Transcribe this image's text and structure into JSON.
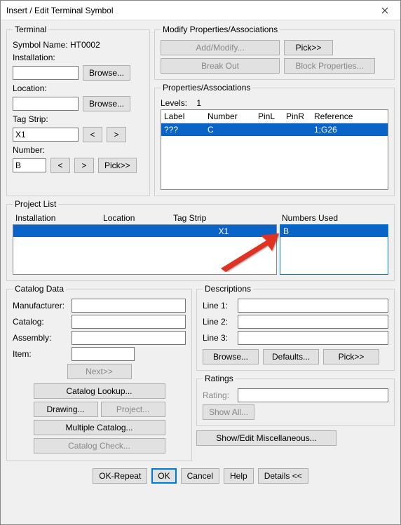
{
  "window": {
    "title": "Insert / Edit Terminal Symbol"
  },
  "terminal": {
    "legend": "Terminal",
    "symbolNameLabel": "Symbol Name:",
    "symbolName": "HT0002",
    "installationLabel": "Installation:",
    "installation": "",
    "browse": "Browse...",
    "locationLabel": "Location:",
    "location": "",
    "tagStripLabel": "Tag Strip:",
    "tagStrip": "X1",
    "prev": "<",
    "next": ">",
    "numberLabel": "Number:",
    "number": "B",
    "pick": "Pick>>"
  },
  "modify": {
    "legend": "Modify Properties/Associations",
    "addModify": "Add/Modify...",
    "pick": "Pick>>",
    "breakOut": "Break Out",
    "blockProps": "Block Properties..."
  },
  "propsAssoc": {
    "legend": "Properties/Associations",
    "levelsLabel": "Levels:",
    "levels": "1",
    "cols": {
      "label": "Label",
      "number": "Number",
      "pinL": "PinL",
      "pinR": "PinR",
      "reference": "Reference"
    },
    "rows": [
      {
        "label": "???",
        "number": "C",
        "pinL": "",
        "pinR": "",
        "reference": "1;G26"
      }
    ]
  },
  "projectList": {
    "legend": "Project List",
    "cols": {
      "installation": "Installation",
      "location": "Location",
      "tagStrip": "Tag Strip",
      "numbersUsed": "Numbers Used"
    },
    "row": {
      "installation": "",
      "location": "",
      "tagStrip": "X1",
      "numbersUsed": "B"
    }
  },
  "catalog": {
    "legend": "Catalog Data",
    "manufacturerLabel": "Manufacturer:",
    "manufacturer": "",
    "catalogLabel": "Catalog:",
    "catalogVal": "",
    "assemblyLabel": "Assembly:",
    "assembly": "",
    "itemLabel": "Item:",
    "item": "",
    "next": "Next>>",
    "lookup": "Catalog Lookup...",
    "drawing": "Drawing...",
    "project": "Project...",
    "multiple": "Multiple Catalog...",
    "check": "Catalog Check..."
  },
  "descriptions": {
    "legend": "Descriptions",
    "line1Label": "Line 1:",
    "line1": "",
    "line2Label": "Line 2:",
    "line2": "",
    "line3Label": "Line 3:",
    "line3": "",
    "browse": "Browse...",
    "defaults": "Defaults...",
    "pick": "Pick>>"
  },
  "ratings": {
    "legend": "Ratings",
    "ratingLabel": "Rating:",
    "rating": "",
    "showAll": "Show All..."
  },
  "misc": {
    "showEdit": "Show/Edit Miscellaneous..."
  },
  "footer": {
    "okRepeat": "OK-Repeat",
    "ok": "OK",
    "cancel": "Cancel",
    "help": "Help",
    "details": "Details <<"
  }
}
